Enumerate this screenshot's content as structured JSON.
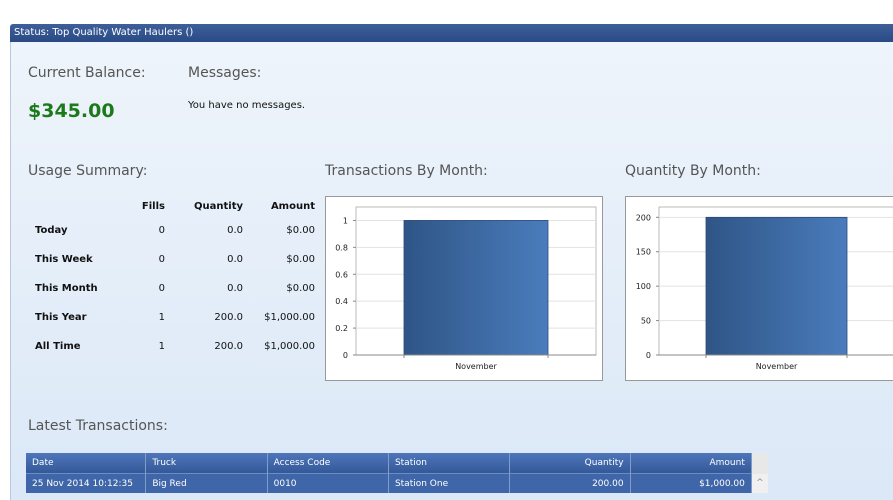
{
  "status_title": "Status: Top Quality Water Haulers ()",
  "balance": {
    "heading": "Current Balance:",
    "amount": "$345.00"
  },
  "messages": {
    "heading": "Messages:",
    "text": "You have no messages."
  },
  "usage": {
    "heading": "Usage Summary:",
    "columns": [
      "Fills",
      "Quantity",
      "Amount"
    ],
    "rows": [
      {
        "label": "Today",
        "fills": "0",
        "quantity": "0.0",
        "amount": "$0.00"
      },
      {
        "label": "This Week",
        "fills": "0",
        "quantity": "0.0",
        "amount": "$0.00"
      },
      {
        "label": "This Month",
        "fills": "0",
        "quantity": "0.0",
        "amount": "$0.00"
      },
      {
        "label": "This Year",
        "fills": "1",
        "quantity": "200.0",
        "amount": "$1,000.00"
      },
      {
        "label": "All Time",
        "fills": "1",
        "quantity": "200.0",
        "amount": "$1,000.00"
      }
    ]
  },
  "chart_data": [
    {
      "type": "bar",
      "title": "Transactions By Month:",
      "categories": [
        "November"
      ],
      "values": [
        1
      ],
      "ylim": [
        0,
        1.1
      ],
      "yticks": [
        "0",
        "0.2",
        "0.4",
        "0.6",
        "0.8",
        "1"
      ],
      "grid": true,
      "color": "#3e6aa3"
    },
    {
      "type": "bar",
      "title": "Quantity By Month:",
      "categories": [
        "November"
      ],
      "values": [
        200
      ],
      "ylim": [
        0,
        215
      ],
      "yticks": [
        "0",
        "50",
        "100",
        "150",
        "200"
      ],
      "grid": true,
      "color": "#3e6aa3"
    }
  ],
  "transactions": {
    "heading": "Latest Transactions:",
    "columns": [
      "Date",
      "Truck",
      "Access Code",
      "Station",
      "Quantity",
      "Amount"
    ],
    "rows": [
      [
        "25 Nov 2014 10:12:35",
        "Big Red",
        "0010",
        "Station One",
        "200.00",
        "$1,000.00"
      ]
    ]
  }
}
